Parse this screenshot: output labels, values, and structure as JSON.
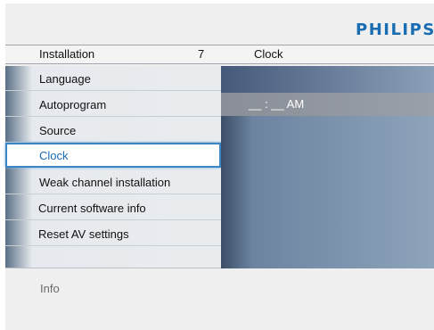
{
  "brand": {
    "logo_text": "PHILIPS"
  },
  "header": {
    "title": "Installation",
    "number": "7",
    "right_title": "Clock"
  },
  "menu": {
    "items": [
      {
        "label": "Language",
        "selected": false
      },
      {
        "label": "Autoprogram",
        "selected": false
      },
      {
        "label": "Source",
        "selected": false
      },
      {
        "label": "Clock",
        "selected": true
      },
      {
        "label": "Weak channel installation",
        "selected": false
      },
      {
        "label": "Current software info",
        "selected": false
      },
      {
        "label": "Reset AV settings",
        "selected": false
      },
      {
        "label": "",
        "selected": false
      }
    ]
  },
  "clock": {
    "value": "__ : __ AM"
  },
  "footer": {
    "info_label": "Info"
  },
  "colors": {
    "accent": "#1a6db3",
    "selection_border": "#3a86c4",
    "panel_blue": "#6c84a0"
  }
}
